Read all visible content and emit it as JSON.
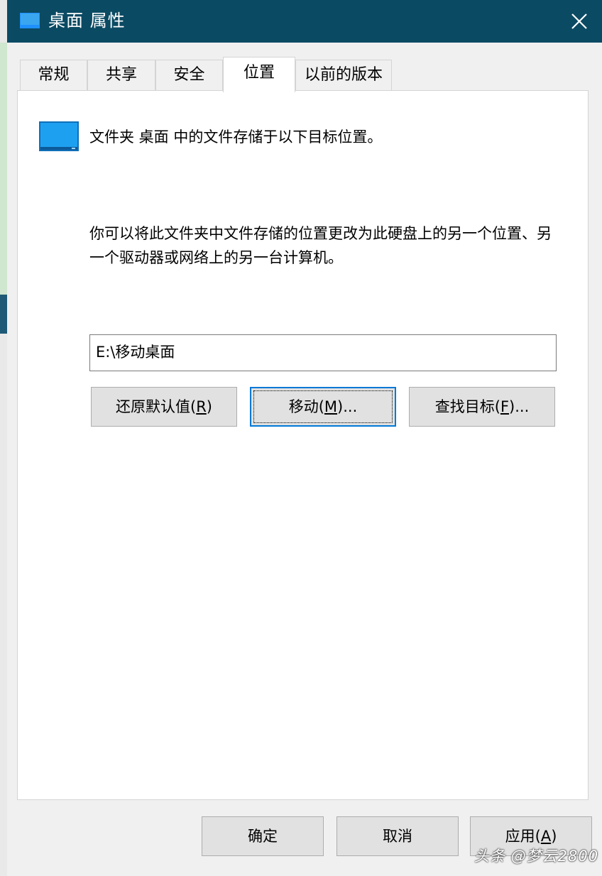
{
  "window": {
    "title": "桌面 属性",
    "accent_color": "#0b4a63",
    "close_icon": "close-icon"
  },
  "tabs": [
    {
      "label": "常规",
      "active": false
    },
    {
      "label": "共享",
      "active": false
    },
    {
      "label": "安全",
      "active": false
    },
    {
      "label": "位置",
      "active": true
    },
    {
      "label": "以前的版本",
      "active": false
    }
  ],
  "location": {
    "heading": "文件夹 桌面 中的文件存储于以下目标位置。",
    "description": "你可以将此文件夹中文件存储的位置更改为此硬盘上的另一个位置、另一个驱动器或网络上的另一台计算机。",
    "path_value": "E:\\移动桌面",
    "buttons": {
      "restore": {
        "label": "还原默认值(",
        "key": "R",
        "suffix": ")"
      },
      "move": {
        "label": "移动(",
        "key": "M",
        "suffix": ")..."
      },
      "find": {
        "label": "查找目标(",
        "key": "F",
        "suffix": ")..."
      }
    }
  },
  "footer": {
    "ok": "确定",
    "cancel": "取消",
    "apply": {
      "label": "应用(",
      "key": "A",
      "suffix": ")"
    }
  },
  "watermark": "头条 @梦云2800"
}
